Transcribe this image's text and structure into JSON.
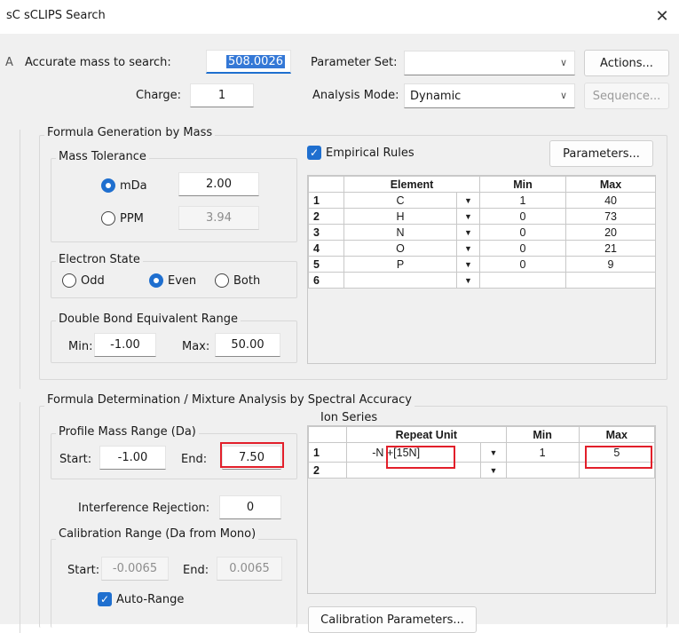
{
  "window": {
    "title": "sC  sCLIPS Search",
    "close_glyph": "✕"
  },
  "header": {
    "side_letter": "A",
    "mass_label": "Accurate mass to search:",
    "mass_value": "508.0026",
    "charge_label": "Charge:",
    "charge_value": "1",
    "param_set_label": "Parameter Set:",
    "param_set_value": "",
    "analysis_mode_label": "Analysis Mode:",
    "analysis_mode_value": "Dynamic",
    "actions_label": "Actions...",
    "sequence_label": "Sequence..."
  },
  "formula_generation": {
    "title": "Formula Generation by Mass",
    "mass_tolerance": {
      "title": "Mass Tolerance",
      "mda_label": "mDa",
      "mda_value": "2.00",
      "ppm_label": "PPM",
      "ppm_value": "3.94",
      "selected": "mDa"
    },
    "electron_state": {
      "title": "Electron State",
      "options": [
        "Odd",
        "Even",
        "Both"
      ],
      "selected": "Even"
    },
    "dbe_range": {
      "title": "Double Bond Equivalent Range",
      "min_label": "Min:",
      "min_value": "-1.00",
      "max_label": "Max:",
      "max_value": "50.00"
    },
    "empirical_rules_label": "Empirical Rules",
    "empirical_rules_checked": true,
    "parameters_label": "Parameters...",
    "element_table": {
      "headers": [
        "Element",
        "Min",
        "Max"
      ],
      "rows": [
        {
          "num": "1",
          "element": "C",
          "min": "1",
          "max": "40"
        },
        {
          "num": "2",
          "element": "H",
          "min": "0",
          "max": "73"
        },
        {
          "num": "3",
          "element": "N",
          "min": "0",
          "max": "20"
        },
        {
          "num": "4",
          "element": "O",
          "min": "0",
          "max": "21"
        },
        {
          "num": "5",
          "element": "P",
          "min": "0",
          "max": "9"
        },
        {
          "num": "6",
          "element": "",
          "min": "",
          "max": ""
        }
      ]
    }
  },
  "formula_determination": {
    "title": "Formula Determination / Mixture Analysis by Spectral Accuracy",
    "profile_range": {
      "title": "Profile Mass Range (Da)",
      "start_label": "Start:",
      "start_value": "-1.00",
      "end_label": "End:",
      "end_value": "7.50"
    },
    "interference_label": "Interference Rejection:",
    "interference_value": "0",
    "calibration_range": {
      "title": "Calibration Range (Da from Mono)",
      "start_label": "Start:",
      "start_value": "-0.0065",
      "end_label": "End:",
      "end_value": "0.0065"
    },
    "auto_range_label": "Auto-Range",
    "auto_range_checked": true,
    "ion_series_label": "Ion Series",
    "ion_table": {
      "headers": [
        "Repeat Unit",
        "Min",
        "Max"
      ],
      "rows": [
        {
          "num": "1",
          "unit": "-N +[15N]",
          "min": "1",
          "max": "5"
        },
        {
          "num": "2",
          "unit": "",
          "min": "",
          "max": ""
        }
      ]
    },
    "calibration_params_label": "Calibration Parameters..."
  },
  "colors": {
    "accent": "#1f6fcf",
    "highlight_red": "#e21f2a",
    "dialog_bg": "#f0f0f0"
  },
  "icons": {
    "dropdown": "chevron-down-icon",
    "close": "close-icon",
    "check": "check-icon"
  }
}
